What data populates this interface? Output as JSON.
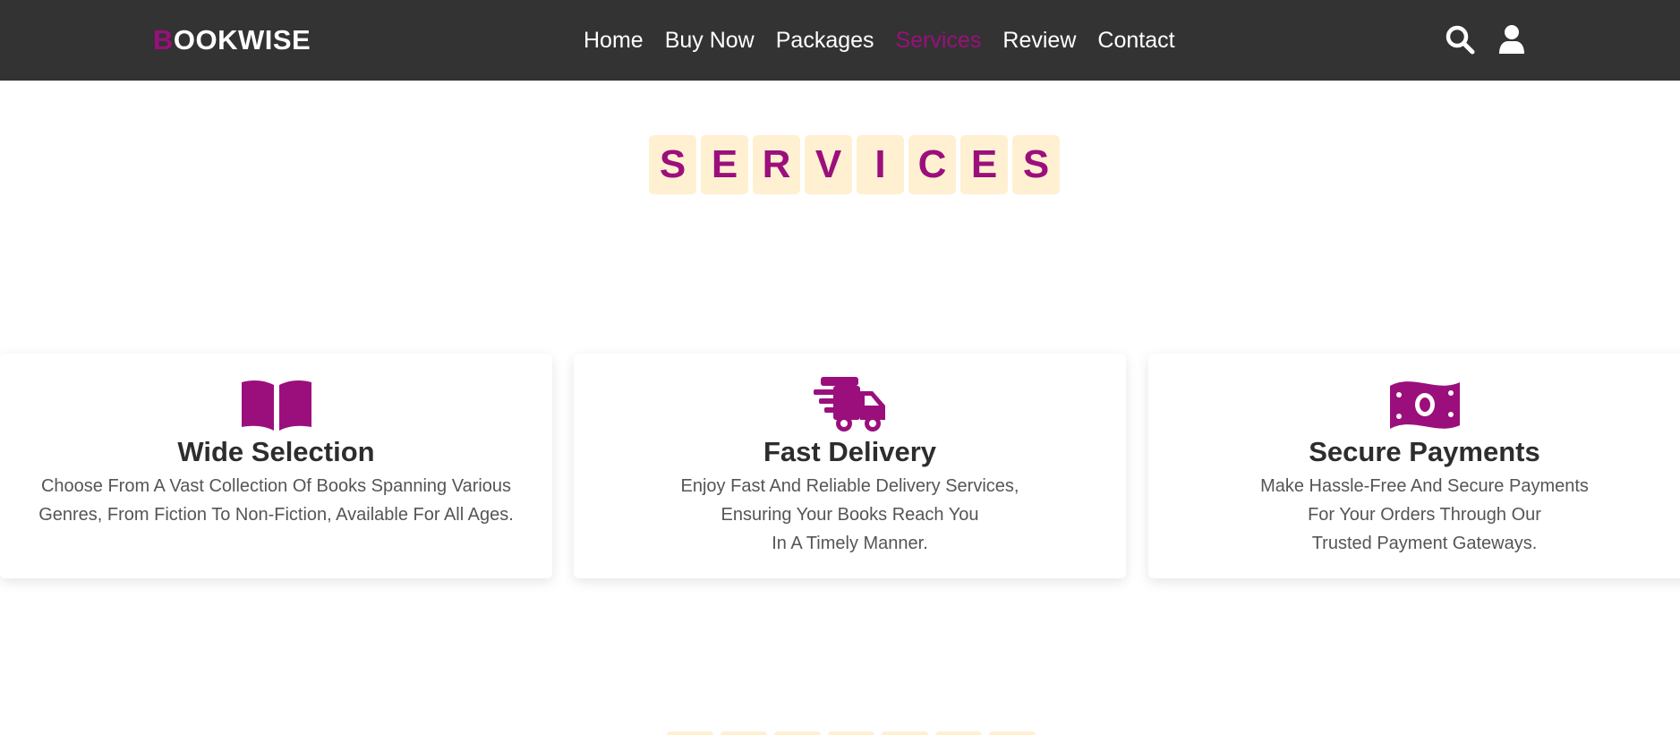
{
  "header": {
    "logo_first": "B",
    "logo_rest": "OOKWISE",
    "nav": [
      {
        "label": "Home"
      },
      {
        "label": "Buy Now"
      },
      {
        "label": "Packages"
      },
      {
        "label": "Services",
        "active": true
      },
      {
        "label": "Review"
      },
      {
        "label": "Contact"
      }
    ],
    "icons": [
      "search-icon",
      "user-icon"
    ]
  },
  "section": {
    "title_letters": [
      "S",
      "E",
      "R",
      "V",
      "I",
      "C",
      "E",
      "S"
    ]
  },
  "cards": [
    {
      "icon": "book-icon",
      "title": "Wide Selection",
      "text": "Choose From A Vast Collection Of Books Spanning Various Genres, From Fiction To Non-Fiction, Available For All Ages."
    },
    {
      "icon": "truck-icon",
      "title": "Fast Delivery",
      "text": "Enjoy Fast And Reliable Delivery Services,\nEnsuring Your Books Reach You\nIn A Timely Manner."
    },
    {
      "icon": "money-icon",
      "title": "Secure Payments",
      "text": "Make Hassle-Free And Secure Payments\nFor Your Orders Through Our\nTrusted Payment Gateways."
    }
  ],
  "colors": {
    "accent": "#9b0f7c",
    "navbar": "#333333",
    "tile": "#fff0d2"
  }
}
